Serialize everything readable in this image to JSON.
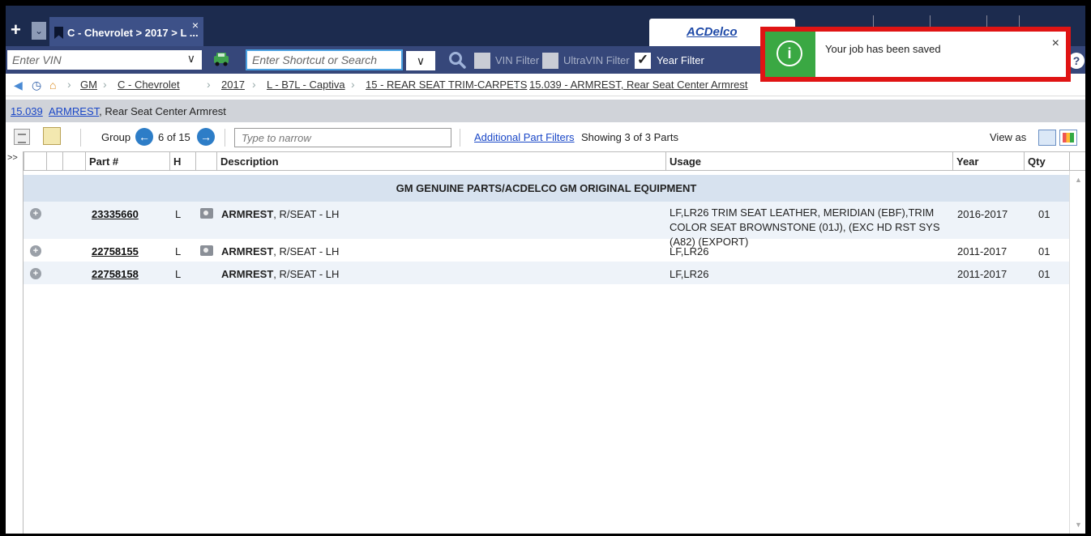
{
  "tabs": {
    "add_label": "+",
    "dropdown_label": "⌄",
    "active_tab_label": "C - Chevrolet > 2017 > L ...",
    "close_label": "×",
    "brand": "ACDelco"
  },
  "toolbar": {
    "vin_placeholder": "Enter VIN",
    "search_placeholder": "Enter Shortcut or Search",
    "vin_filter_label": "VIN Filter",
    "vin_filter_checked": false,
    "ultravin_filter_label": "UltraVIN Filter",
    "ultravin_filter_checked": false,
    "year_filter_label": "Year Filter",
    "year_filter_checked": true,
    "help_label": "?"
  },
  "breadcrumb": {
    "items": [
      "GM",
      "C - Chevrolet",
      "2017",
      "L - B7L - Captiva",
      "15 - REAR SEAT TRIM-CARPETS",
      "15.039 - ARMREST, Rear Seat Center Armrest"
    ]
  },
  "section": {
    "code": "15.039",
    "name": "ARMREST",
    "rest": ", Rear Seat Center Armrest"
  },
  "controls": {
    "group_label": "Group",
    "group_count": "6 of 15",
    "narrow_placeholder": "Type to narrow",
    "additional_filters_label": "Additional Part Filters",
    "showing_text": "Showing 3 of 3 Parts",
    "view_as_label": "View as"
  },
  "table": {
    "expand_label": ">>",
    "headers": {
      "part": "Part #",
      "h": "H",
      "description": "Description",
      "usage": "Usage",
      "year": "Year",
      "qty": "Qty"
    },
    "group_title": "GM GENUINE PARTS/ACDELCO GM ORIGINAL EQUIPMENT",
    "rows": [
      {
        "part": "23335660",
        "h": "L",
        "has_photo": true,
        "desc_bold": "ARMREST",
        "desc_rest": ", R/SEAT - LH",
        "usage": "LF,LR26 TRIM SEAT LEATHER, MERIDIAN (EBF),TRIM COLOR SEAT BROWNSTONE (01J), (EXC HD RST SYS (A82) (EXPORT)",
        "year": "2016-2017",
        "qty": "01"
      },
      {
        "part": "22758155",
        "h": "L",
        "has_photo": true,
        "desc_bold": "ARMREST",
        "desc_rest": ", R/SEAT - LH",
        "usage": "LF,LR26",
        "year": "2011-2017",
        "qty": "01"
      },
      {
        "part": "22758158",
        "h": "L",
        "has_photo": false,
        "desc_bold": "ARMREST",
        "desc_rest": ", R/SEAT - LH",
        "usage": "LF,LR26",
        "year": "2011-2017",
        "qty": "01"
      }
    ]
  },
  "toast": {
    "message": "Your job has been saved",
    "icon": "info-icon",
    "close_label": "×",
    "accent_color": "#3aa843",
    "highlight_color": "#e01414"
  },
  "colors": {
    "header_bg": "#1c2b4e",
    "toolbar_bg": "#36477a",
    "link": "#1a47c7",
    "group_row_bg": "#d7e2ef"
  }
}
